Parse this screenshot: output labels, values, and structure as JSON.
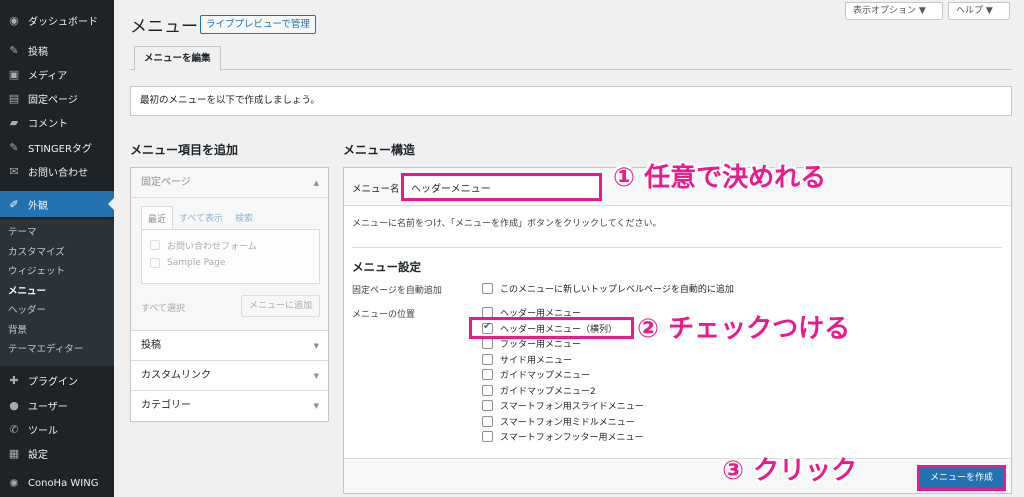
{
  "sidebar": {
    "items": [
      {
        "icon": "dashboard-icon",
        "glyph": "◉",
        "label": "ダッシュボード"
      },
      {
        "icon": "pin-icon",
        "glyph": "✎",
        "label": "投稿"
      },
      {
        "icon": "media-icon",
        "glyph": "▣",
        "label": "メディア"
      },
      {
        "icon": "page-icon",
        "glyph": "▤",
        "label": "固定ページ"
      },
      {
        "icon": "comment-icon",
        "glyph": "▰",
        "label": "コメント"
      },
      {
        "icon": "pin-icon",
        "glyph": "✎",
        "label": "STINGERタグ"
      },
      {
        "icon": "mail-icon",
        "glyph": "✉",
        "label": "お問い合わせ"
      }
    ],
    "active": {
      "icon": "brush-icon",
      "glyph": "✐",
      "label": "外観"
    },
    "submenu": [
      "テーマ",
      "カスタマイズ",
      "ウィジェット",
      "メニュー",
      "ヘッダー",
      "背景",
      "テーマエディター"
    ],
    "current_sub": "メニュー",
    "bottom_items": [
      {
        "icon": "plugin-icon",
        "glyph": "✚",
        "label": "プラグイン"
      },
      {
        "icon": "user-icon",
        "glyph": "●",
        "label": "ユーザー"
      },
      {
        "icon": "tool-icon",
        "glyph": "✆",
        "label": "ツール"
      },
      {
        "icon": "settings-icon",
        "glyph": "▦",
        "label": "設定"
      },
      {
        "icon": "gear-icon",
        "glyph": "✺",
        "label": "ConoHa WING"
      }
    ]
  },
  "header": {
    "title": "メニュー",
    "live_preview": "ライブプレビューで管理",
    "screen_options": "表示オプション ▼",
    "help": "ヘルプ ▼"
  },
  "tabs": {
    "edit": "メニューを編集"
  },
  "notice": "最初のメニューを以下で作成しましょう。",
  "add_items": {
    "heading": "メニュー項目を追加",
    "pages": {
      "title": "固定ページ",
      "tabs": [
        "最近",
        "すべて表示",
        "検索"
      ],
      "items": [
        "お問い合わせフォーム",
        "Sample Page"
      ],
      "select_all": "すべて選択",
      "add_button": "メニューに追加"
    },
    "sections": [
      "投稿",
      "カスタムリンク",
      "カテゴリー"
    ]
  },
  "structure": {
    "heading": "メニュー構造",
    "name_label": "メニュー名",
    "name_value": "ヘッダーメニュー",
    "instructions": "メニューに名前をつけ、「メニューを作成」ボタンをクリックしてください。",
    "settings_heading": "メニュー設定",
    "auto_add_label": "固定ページを自動追加",
    "auto_add_option": "このメニューに新しいトップレベルページを自動的に追加",
    "locations_label": "メニューの位置",
    "locations": [
      {
        "label": "ヘッダー用メニュー",
        "checked": false
      },
      {
        "label": "ヘッダー用メニュー（横列）",
        "checked": true
      },
      {
        "label": "フッター用メニュー",
        "checked": false
      },
      {
        "label": "サイド用メニュー",
        "checked": false
      },
      {
        "label": "ガイドマップメニュー",
        "checked": false
      },
      {
        "label": "ガイドマップメニュー2",
        "checked": false
      },
      {
        "label": "スマートフォン用スライドメニュー",
        "checked": false
      },
      {
        "label": "スマートフォン用ミドルメニュー",
        "checked": false
      },
      {
        "label": "スマートフォンフッター用メニュー",
        "checked": false
      }
    ],
    "save_button": "メニューを作成"
  },
  "annotations": {
    "step1": "① 任意で決めれる",
    "step2": "② チェックつける",
    "step3": "③ クリック"
  },
  "colors": {
    "accent": "#2271b1",
    "annotation": "#ea1a8c",
    "sidebar_bg": "#1d2327"
  }
}
